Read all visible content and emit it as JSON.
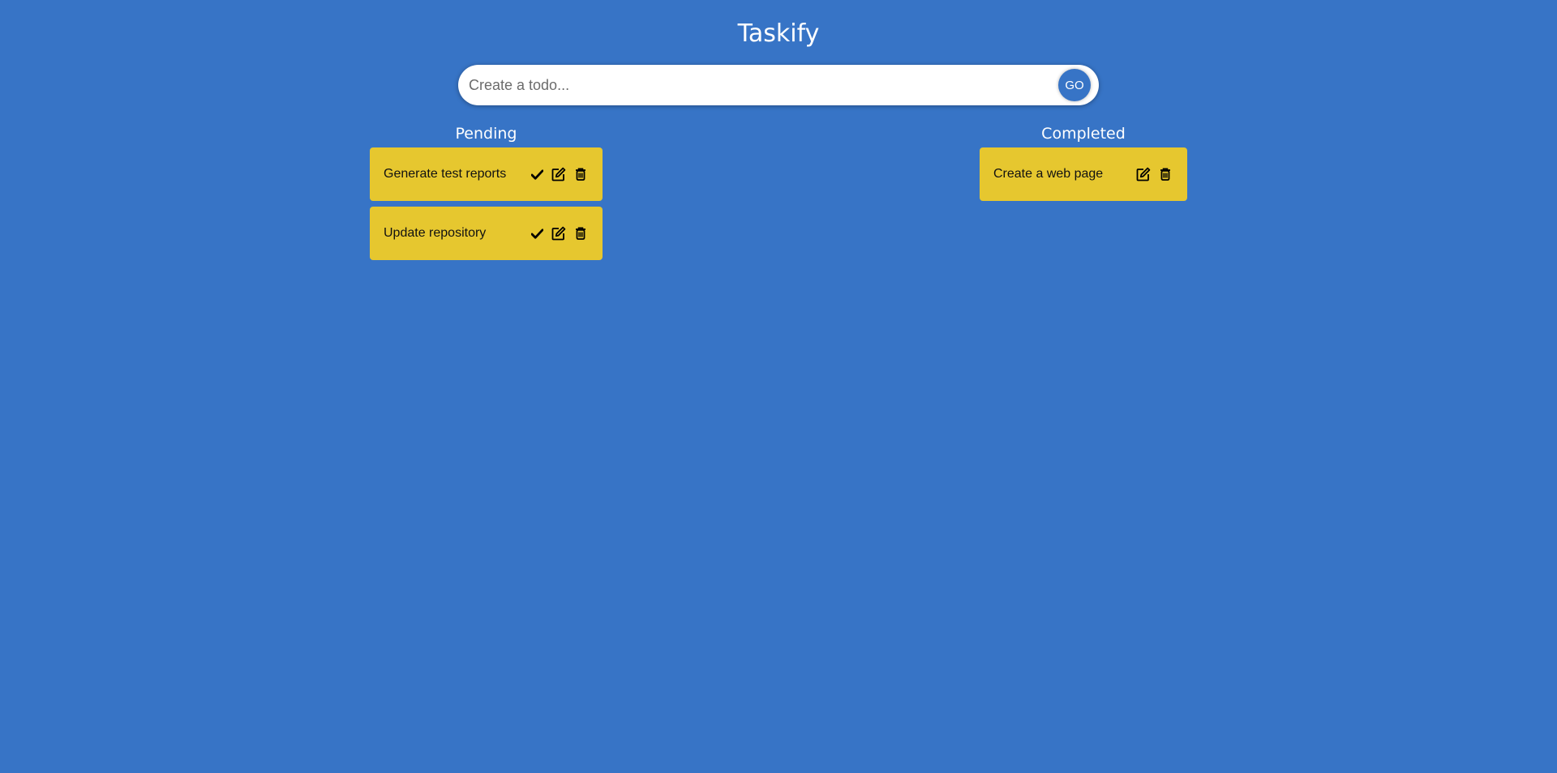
{
  "app": {
    "title": "Taskify"
  },
  "input": {
    "placeholder": "Create a todo...",
    "value": "",
    "submit_label": "GO"
  },
  "columns": {
    "pending": {
      "heading": "Pending",
      "items": [
        {
          "text": "Generate test reports",
          "actions": [
            "check-icon",
            "edit-icon",
            "trash-icon"
          ]
        },
        {
          "text": "Update repository",
          "actions": [
            "check-icon",
            "edit-icon",
            "trash-icon"
          ]
        }
      ]
    },
    "completed": {
      "heading": "Completed",
      "items": [
        {
          "text": "Create a web page",
          "actions": [
            "edit-icon",
            "trash-icon"
          ]
        }
      ]
    }
  },
  "colors": {
    "background": "#3774c6",
    "card": "#e6c72f",
    "text_light": "#ffffff",
    "text_dark": "#111111"
  }
}
